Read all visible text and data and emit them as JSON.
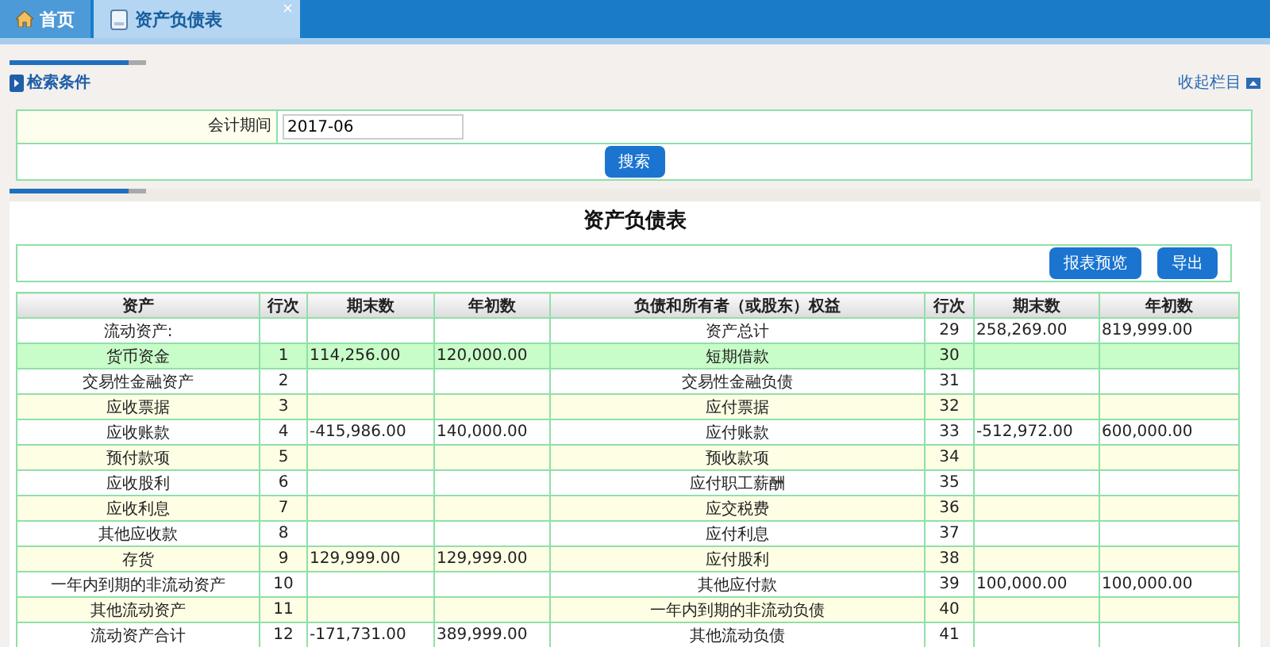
{
  "tabs": [
    {
      "label": "首页",
      "kind": "home",
      "selected": false
    },
    {
      "label": "资产负债表",
      "kind": "page",
      "selected": true,
      "close": "×"
    }
  ],
  "search_section": {
    "title": "检索条件",
    "collapse_link": "收起栏目",
    "field_label": "会计期间",
    "field_value": "2017-06",
    "search_button": "搜索"
  },
  "report": {
    "title": "资产负债表",
    "buttons": [
      "报表预览",
      "导出"
    ],
    "columns": [
      "资产",
      "行次",
      "期末数",
      "年初数",
      "负债和所有者（或股东）权益",
      "行次",
      "期末数",
      "年初数"
    ],
    "rows": [
      {
        "cells": [
          "流动资产:",
          "",
          "",
          "",
          "资产总计",
          "29",
          "258,269.00",
          "819,999.00"
        ],
        "selected": false
      },
      {
        "cells": [
          "货币资金",
          "1",
          "114,256.00",
          "120,000.00",
          "短期借款",
          "30",
          "",
          ""
        ],
        "selected": true
      },
      {
        "cells": [
          "交易性金融资产",
          "2",
          "",
          "",
          "交易性金融负债",
          "31",
          "",
          ""
        ],
        "selected": false
      },
      {
        "cells": [
          "应收票据",
          "3",
          "",
          "",
          "应付票据",
          "32",
          "",
          ""
        ],
        "selected": false
      },
      {
        "cells": [
          "应收账款",
          "4",
          "-415,986.00",
          "140,000.00",
          "应付账款",
          "33",
          "-512,972.00",
          "600,000.00"
        ],
        "selected": false
      },
      {
        "cells": [
          "预付款项",
          "5",
          "",
          "",
          "预收款项",
          "34",
          "",
          ""
        ],
        "selected": false
      },
      {
        "cells": [
          "应收股利",
          "6",
          "",
          "",
          "应付职工薪酬",
          "35",
          "",
          ""
        ],
        "selected": false
      },
      {
        "cells": [
          "应收利息",
          "7",
          "",
          "",
          "应交税费",
          "36",
          "",
          ""
        ],
        "selected": false
      },
      {
        "cells": [
          "其他应收款",
          "8",
          "",
          "",
          "应付利息",
          "37",
          "",
          ""
        ],
        "selected": false
      },
      {
        "cells": [
          "存货",
          "9",
          "129,999.00",
          "129,999.00",
          "应付股利",
          "38",
          "",
          ""
        ],
        "selected": false
      },
      {
        "cells": [
          "一年内到期的非流动资产",
          "10",
          "",
          "",
          "其他应付款",
          "39",
          "100,000.00",
          "100,000.00"
        ],
        "selected": false
      },
      {
        "cells": [
          "其他流动资产",
          "11",
          "",
          "",
          "一年内到期的非流动负债",
          "40",
          "",
          ""
        ],
        "selected": false
      },
      {
        "cells": [
          "流动资产合计",
          "12",
          "-171,731.00",
          "389,999.00",
          "其他流动负债",
          "41",
          "",
          ""
        ],
        "selected": false
      }
    ]
  }
}
